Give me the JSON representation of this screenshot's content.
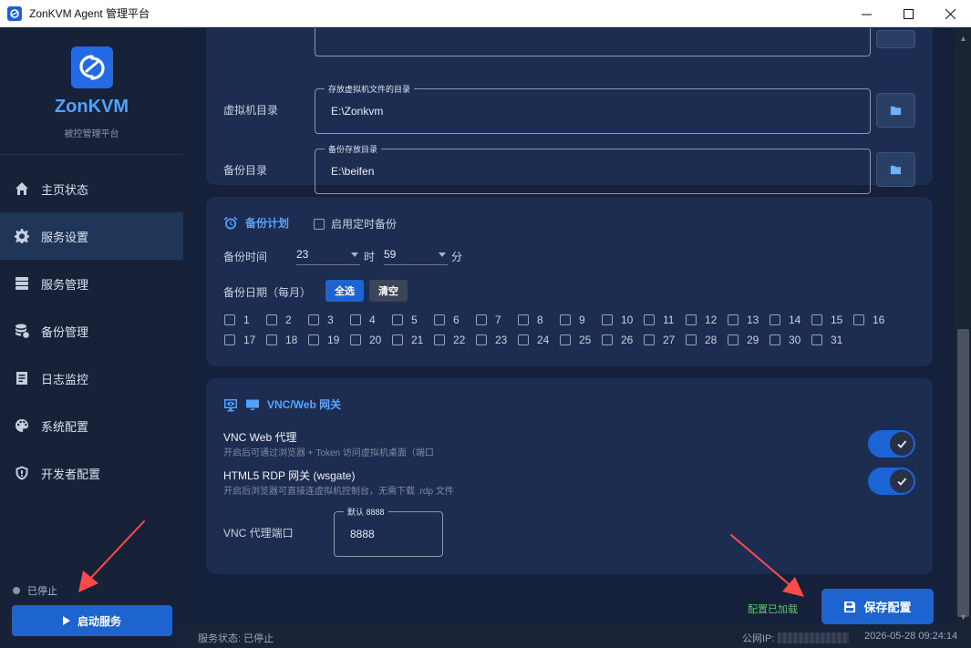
{
  "window": {
    "title": "ZonKVM Agent 管理平台",
    "controls": [
      "minimize",
      "maximize",
      "close"
    ]
  },
  "sidebar": {
    "brand": "ZonKVM",
    "subtitle": "被控管理平台",
    "items": [
      {
        "label": "主页状态",
        "icon": "home-icon",
        "active": false
      },
      {
        "label": "服务设置",
        "icon": "gear-icon",
        "active": true
      },
      {
        "label": "服务管理",
        "icon": "server-icon",
        "active": false
      },
      {
        "label": "备份管理",
        "icon": "database-icon",
        "active": false
      },
      {
        "label": "日志监控",
        "icon": "log-icon",
        "active": false
      },
      {
        "label": "系统配置",
        "icon": "palette-icon",
        "active": false
      },
      {
        "label": "开发者配置",
        "icon": "shield-icon",
        "active": false
      }
    ],
    "service_status": "已停止",
    "start_button": "启动服务"
  },
  "directories": {
    "vm_dir": {
      "label": "虚拟机目录",
      "legend": "存放虚拟机文件的目录",
      "value": "E:\\Zonkvm"
    },
    "backup_dir": {
      "label": "备份目录",
      "legend": "备份存放目录",
      "value": "E:\\beifen"
    }
  },
  "backup_plan": {
    "title": "备份计划",
    "enable_label": "启用定时备份",
    "enabled": false,
    "time_label": "备份时间",
    "hour": "23",
    "hour_unit": "时",
    "minute": "59",
    "minute_unit": "分",
    "date_label": "备份日期（每月）",
    "select_all": "全选",
    "clear": "清空",
    "days": [
      "1",
      "2",
      "3",
      "4",
      "5",
      "6",
      "7",
      "8",
      "9",
      "10",
      "11",
      "12",
      "13",
      "14",
      "15",
      "16",
      "17",
      "18",
      "19",
      "20",
      "21",
      "22",
      "23",
      "24",
      "25",
      "26",
      "27",
      "28",
      "29",
      "30",
      "31"
    ]
  },
  "vnc": {
    "title": "VNC/Web 网关",
    "proxy_title": "VNC Web 代理",
    "proxy_desc": "开启后可通过浏览器 + Token 访问虚拟机桌面（端口",
    "proxy_enabled": true,
    "rdp_title": "HTML5 RDP 网关 (wsgate)",
    "rdp_desc": "开启后浏览器可直接连虚拟机控制台，无需下载 .rdp 文件",
    "rdp_enabled": true,
    "port_label": "VNC 代理端口",
    "port_legend": "默认 8888",
    "port_value": "8888"
  },
  "footer": {
    "config_status": "配置已加载",
    "save_button": "保存配置"
  },
  "statusbar": {
    "service_status": "服务状态: 已停止",
    "public_ip_label": "公网IP:",
    "timestamp": "2026-05-28 09:24:14"
  },
  "colors": {
    "accent": "#1e64d0",
    "brand": "#4ea3ff",
    "success": "#5fc76a",
    "annotation_arrow": "#ff4a4a"
  }
}
